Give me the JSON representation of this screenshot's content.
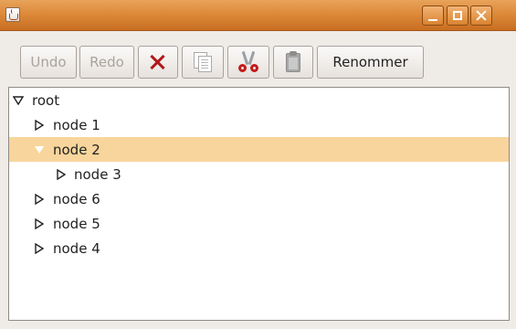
{
  "toolbar": {
    "undo_label": "Undo",
    "redo_label": "Redo",
    "rename_label": "Renommer"
  },
  "tree": {
    "root": "root",
    "items": [
      {
        "label": "node 1",
        "expanded": false,
        "selected": false,
        "depth": 1
      },
      {
        "label": "node 2",
        "expanded": true,
        "selected": true,
        "depth": 1
      },
      {
        "label": "node 3",
        "expanded": false,
        "selected": false,
        "depth": 2
      },
      {
        "label": "node 6",
        "expanded": false,
        "selected": false,
        "depth": 1
      },
      {
        "label": "node 5",
        "expanded": false,
        "selected": false,
        "depth": 1
      },
      {
        "label": "node 4",
        "expanded": false,
        "selected": false,
        "depth": 1
      }
    ]
  },
  "colors": {
    "titlebar": "#dd8a3a",
    "selection": "#f8d59c",
    "delete_icon": "#b01818",
    "cut_icon": "#c41a1a"
  },
  "icons": [
    "java-icon",
    "minimize-icon",
    "maximize-icon",
    "close-icon",
    "delete-icon",
    "copy-icon",
    "cut-icon",
    "paste-icon",
    "expand-triangle-icon",
    "collapse-triangle-icon"
  ]
}
